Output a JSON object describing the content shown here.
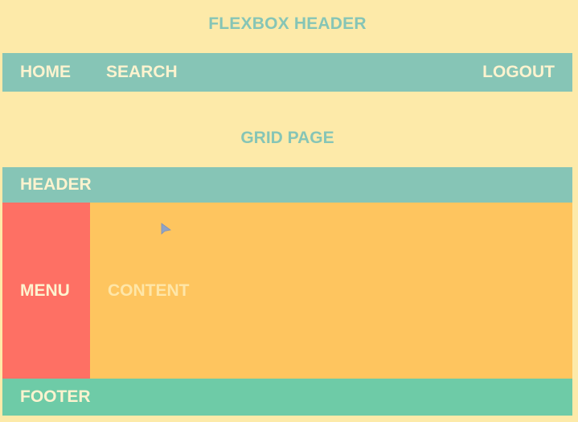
{
  "flexbox": {
    "title": "FLEXBOX HEADER",
    "nav": {
      "home": "HOME",
      "search": "SEARCH",
      "logout": "LOGOUT"
    }
  },
  "grid_page": {
    "title": "GRID PAGE",
    "header": "HEADER",
    "menu": "MENU",
    "content": "CONTENT",
    "footer": "FOOTER"
  },
  "colors": {
    "background": "#fdeaa9",
    "teal": "#86c5b6",
    "menu_red": "#fe7064",
    "content_orange": "#fec55f",
    "footer_green": "#6ecba7",
    "light_text": "#fdf3cf"
  },
  "icons": {
    "cursor": "mouse-pointer-icon"
  }
}
